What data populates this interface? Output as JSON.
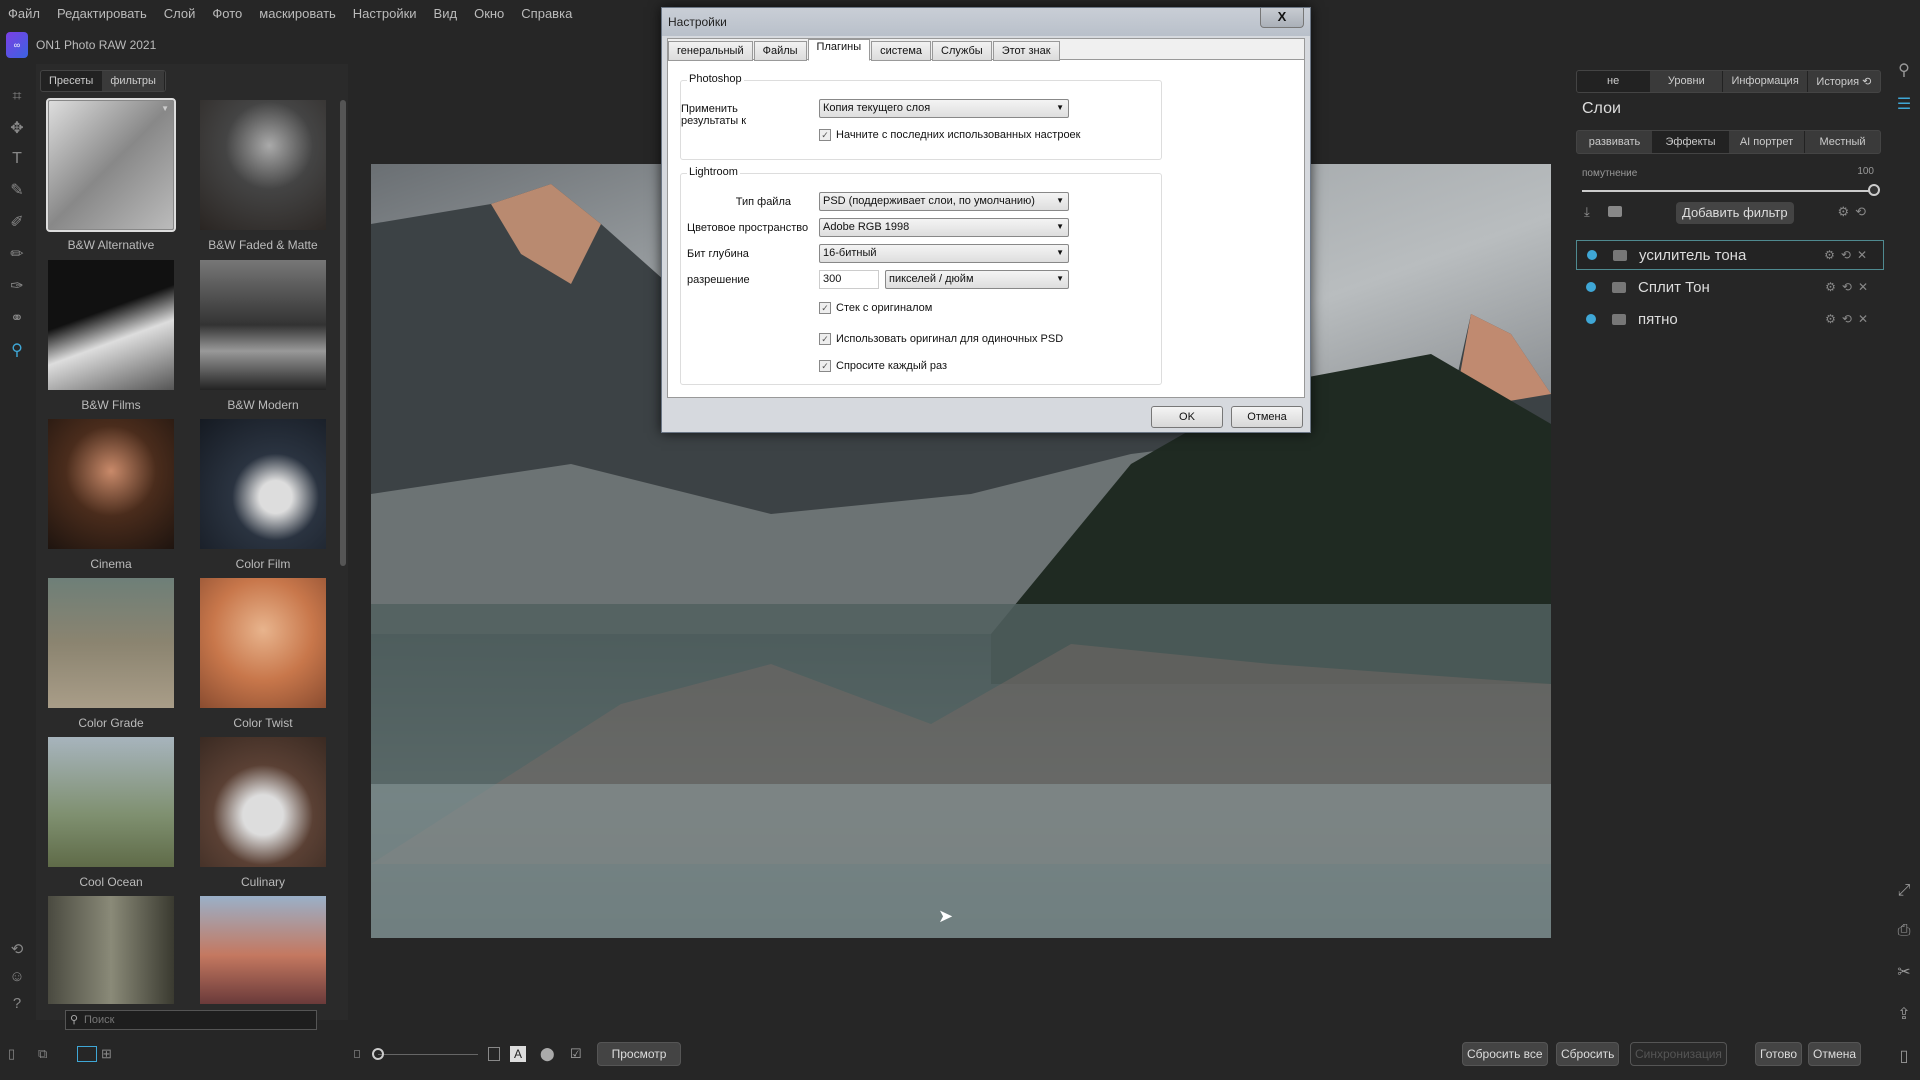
{
  "menu": [
    "Файл",
    "Редактировать",
    "Слой",
    "Фото",
    "маскировать",
    "Настройки",
    "Вид",
    "Окно",
    "Справка"
  ],
  "app": {
    "title": "ON1 Photo RAW 2021",
    "logo": "ON1"
  },
  "browser": {
    "tabs": [
      "Пресеты",
      "фильтры"
    ],
    "active_tab": "Пресеты",
    "presets": [
      {
        "label": "B&W Alternative",
        "bg": "linear-gradient(135deg,#ddd,#888 50%,#bbb)"
      },
      {
        "label": "B&W Faded & Matte",
        "bg": "radial-gradient(circle at 55% 35%,#aaa,#444 40%,#2a2522)"
      },
      {
        "label": "B&W Films",
        "bg": "linear-gradient(160deg,#111 40%,#ddd 60%,#555)"
      },
      {
        "label": "B&W Modern",
        "bg": "linear-gradient(180deg,#777,#333 50%,#999 70%,#222)"
      },
      {
        "label": "Cinema",
        "bg": "radial-gradient(circle at 50% 40%,#c98a6a,#4a2c1c 45%,#1e140f)"
      },
      {
        "label": "Color Film",
        "bg": "radial-gradient(circle at 60% 60%,#ddd 15%,#2a3340 40%,#151a22)"
      },
      {
        "label": "Color Grade",
        "bg": "linear-gradient(180deg,#6e7f78,#8b8470 50%,#a99d88)"
      },
      {
        "label": "Color Twist",
        "bg": "radial-gradient(circle at 50% 40%,#e8b48d,#c8774b 50%,#8a4c30)"
      },
      {
        "label": "Cool Ocean",
        "bg": "linear-gradient(180deg,#a7b4bd,#7f9070 60%,#5f6b48)"
      },
      {
        "label": "Culinary",
        "bg": "radial-gradient(circle at 50% 60%,#ddd 20%,#5a4034 50%,#3a2a22)"
      },
      {
        "label": "",
        "bg": "linear-gradient(90deg,#4a4a40,#8a8a78,#3a3a30)"
      },
      {
        "label": "",
        "bg": "linear-gradient(180deg,#9ab0c8,#c47860 55%,#6a3a3a)"
      }
    ],
    "search_placeholder": "Поиск"
  },
  "dialog": {
    "title": "Настройки",
    "close": "X",
    "tabs": [
      "генеральный",
      "Файлы",
      "Плагины",
      "система",
      "Службы",
      "Этот знак"
    ],
    "active_tab": "Плагины",
    "photoshop": {
      "group": "Photoshop",
      "apply_label": "Применить результаты к",
      "apply_value": "Копия текущего слоя",
      "start_last": {
        "label": "Начните с последних использованных настроек",
        "checked": true
      }
    },
    "lightroom": {
      "group": "Lightroom",
      "file_type_label": "Тип файла",
      "file_type": "PSD (поддерживает слои, по умолчанию)",
      "color_space_label": "Цветовое пространство",
      "color_space": "Adobe RGB 1998",
      "bit_depth_label": "Бит глубина",
      "bit_depth": "16-битный",
      "resolution_label": "разрешение",
      "resolution": "300",
      "resolution_unit": "пикселей / дюйм",
      "checks": [
        {
          "label": "Стек с оригиналом",
          "checked": true
        },
        {
          "label": "Использовать оригинал для одиночных PSD",
          "checked": true
        },
        {
          "label": "Спросите каждый раз",
          "checked": true
        }
      ]
    },
    "ok": "OK",
    "cancel": "Отмена"
  },
  "right": {
    "top_tabs": [
      "не",
      "Уровни",
      "Информация",
      "История"
    ],
    "active_top": "не",
    "section": "Слои",
    "sub_tabs": [
      "развивать",
      "Эффекты",
      "AI портрет",
      "Местный"
    ],
    "active_sub": "Эффекты",
    "opacity_label": "помутнение",
    "opacity": "100",
    "add_filter": "Добавить фильтр",
    "filters": [
      "усилитель тона",
      "Сплит Тон",
      "пятно"
    ],
    "filter_dot_color": "#3fa7d6"
  },
  "bottom": {
    "preview": "Просмотр",
    "reset_all": "Сбросить все",
    "reset": "Сбросить",
    "sync": "Синхронизация",
    "done": "Готово",
    "cancel": "Отмена",
    "zoom_slider": 0
  }
}
